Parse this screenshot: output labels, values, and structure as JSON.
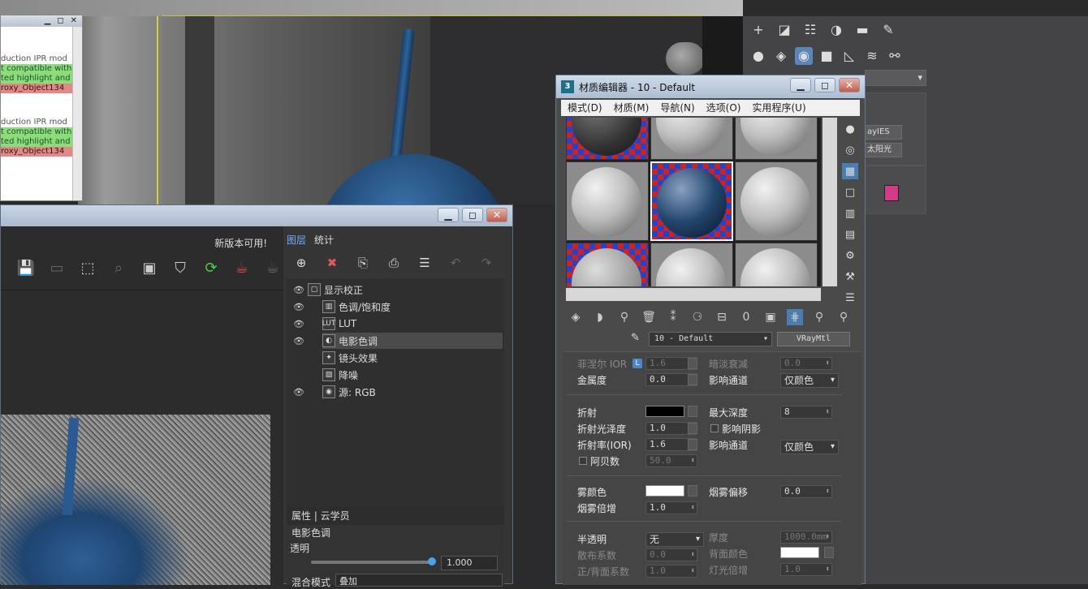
{
  "log": {
    "lines": [
      {
        "text": "duction IPR mod",
        "style": "normal"
      },
      {
        "text": "t compatible with",
        "style": "green"
      },
      {
        "text": "ted highlight and",
        "style": "green"
      },
      {
        "text": "roxy_Object134",
        "style": "red"
      },
      {
        "text": "duction IPR mod",
        "style": "normal"
      },
      {
        "text": "t compatible with",
        "style": "green"
      },
      {
        "text": "ted highlight and",
        "style": "green"
      },
      {
        "text": "roxy_Object134",
        "style": "red"
      }
    ]
  },
  "vfb": {
    "new_version": "新版本可用!",
    "tabs": [
      "图层",
      "统计"
    ],
    "layers": [
      {
        "label": "显示校正",
        "icon": "▢",
        "eye": true,
        "indent": 0,
        "selected": false
      },
      {
        "label": "色调/饱和度",
        "icon": "▥",
        "eye": true,
        "indent": 1,
        "selected": false
      },
      {
        "label": "LUT",
        "icon": "LUT",
        "eye": true,
        "indent": 1,
        "selected": false
      },
      {
        "label": "电影色调",
        "icon": "◐",
        "eye": true,
        "indent": 1,
        "selected": true
      },
      {
        "label": "镜头效果",
        "icon": "✦",
        "eye": false,
        "indent": 1,
        "selected": false
      },
      {
        "label": "降噪",
        "icon": "▧",
        "eye": false,
        "indent": 1,
        "selected": false
      },
      {
        "label": "源: RGB",
        "icon": "◉",
        "eye": true,
        "indent": 1,
        "selected": false
      }
    ],
    "properties": {
      "header": "属性 | 云学员",
      "layer_name": "电影色调",
      "opacity_label": "透明",
      "opacity_value": "1.000",
      "opacity_level": 0.98,
      "blend_label": "混合模式",
      "blend_value": "叠加"
    }
  },
  "material_editor": {
    "title": "材质编辑器 - 10 - Default",
    "menu": [
      "模式(D)",
      "材质(M)",
      "导航(N)",
      "选项(O)",
      "实用程序(U)"
    ],
    "material_name": "10 - Default",
    "material_type": "VRayMtl",
    "params": {
      "fresnel_ior_label": "菲涅尔 IOR",
      "fresnel_ior_value": "1.6",
      "dim_falloff_label": "暗淡衰减",
      "dim_falloff_value": "0.0",
      "metalness_label": "金属度",
      "metalness_value": "0.0",
      "affect_channels_label": "影响通道",
      "affect_channels_value": "仅颜色",
      "refraction_label": "折射",
      "max_depth_label": "最大深度",
      "max_depth_value": "8",
      "refr_gloss_label": "折射光泽度",
      "refr_gloss_value": "1.0",
      "affect_shadows_label": "影响阴影",
      "refr_ior_label": "折射率(IOR)",
      "refr_ior_value": "1.6",
      "affect_channels2_label": "影响通道",
      "affect_channels2_value": "仅颜色",
      "abbe_label": "阿贝数",
      "abbe_value": "50.0",
      "fog_color_label": "雾颜色",
      "fog_bias_label": "烟雾偏移",
      "fog_bias_value": "0.0",
      "fog_mult_label": "烟雾倍增",
      "fog_mult_value": "1.0",
      "translucency_label": "半透明",
      "translucency_value": "无",
      "thickness_label": "厚度",
      "thickness_value": "1000.0mm",
      "scatter_label": "散布系数",
      "scatter_value": "0.0",
      "back_color_label": "背面颜色",
      "fwd_back_label": "正/背面系数",
      "fwd_back_value": "1.0",
      "light_mult_label": "灯光倍增",
      "light_mult_value": "1.0"
    }
  },
  "command_panel": {
    "chips": [
      "ayIES",
      "太阳光"
    ]
  },
  "colors": {
    "accent": "#4a7db0",
    "layer_tab_active": "#6fb1ff",
    "log_green": "#8edc78",
    "log_red": "#e08989",
    "swatch_pink": "#d23a8a"
  }
}
